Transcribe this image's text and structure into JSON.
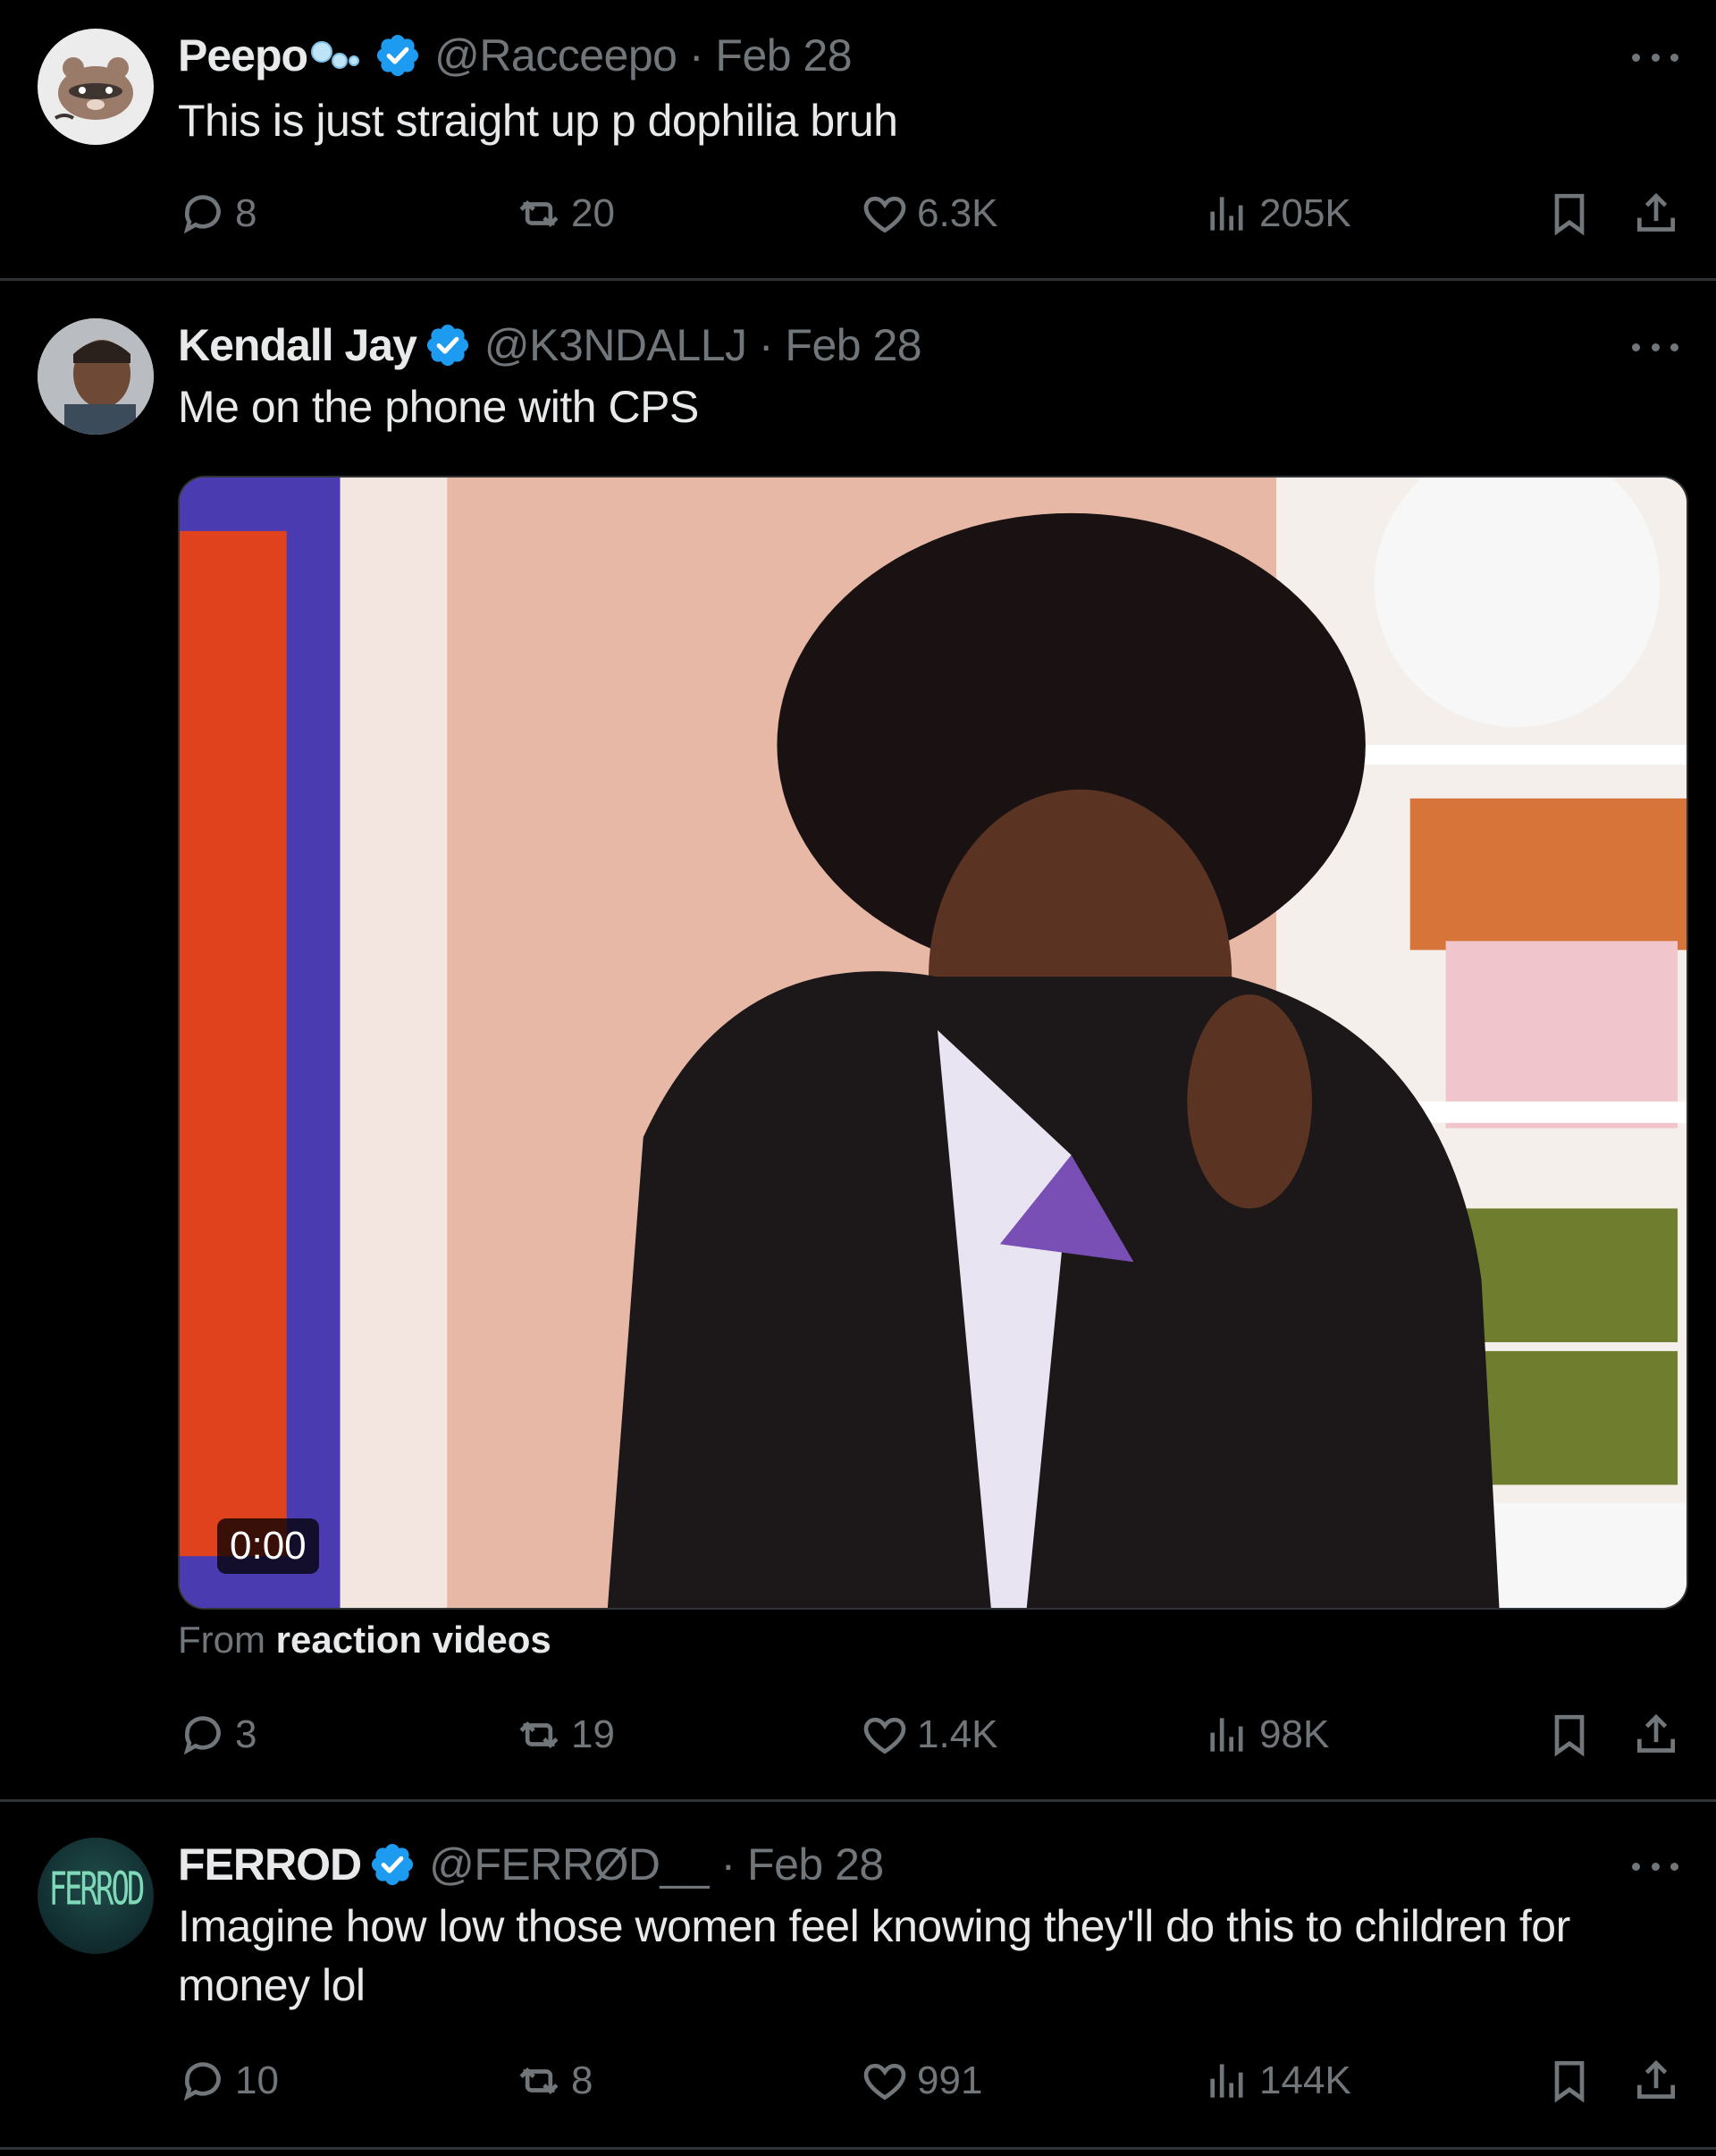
{
  "tweets": [
    {
      "name": "Peepo",
      "handle": "@Racceepo · Feb 28",
      "text": "This is just straight up p  dophilia bruh",
      "replies": "8",
      "reposts": "20",
      "likes": "6.3K",
      "views": "205K"
    },
    {
      "name": "Kendall Jay",
      "handle": "@K3NDALLJ · Feb 28",
      "text": "Me on the phone with CPS",
      "media_duration": "0:00",
      "source_prefix": "From ",
      "source_name": "reaction videos",
      "replies": "3",
      "reposts": "19",
      "likes": "1.4K",
      "views": "98K"
    },
    {
      "name": "FERROD",
      "handle": "@FERRØD__ · Feb 28",
      "text": "Imagine how low those women feel knowing they'll do this to children for money lol",
      "avatar_text": "FERROD",
      "replies": "10",
      "reposts": "8",
      "likes": "991",
      "views": "144K"
    }
  ],
  "colors": {
    "background": "#000000",
    "text": "#e7e9ea",
    "secondary": "#71767b",
    "verified": "#1d9bf0",
    "divider": "#2f3336"
  }
}
